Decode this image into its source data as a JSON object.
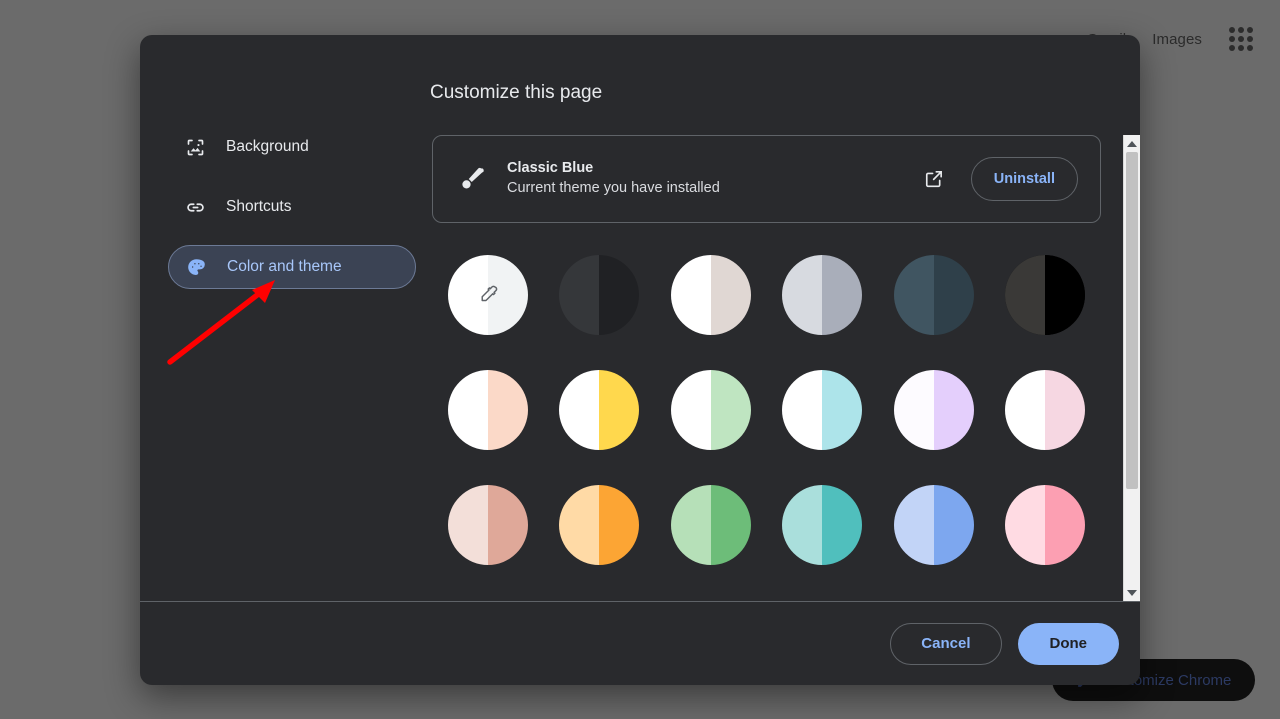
{
  "background_page": {
    "links": [
      {
        "label": "Gmail",
        "name": "gmail-link"
      },
      {
        "label": "Images",
        "name": "images-link"
      }
    ],
    "apps_icon": "apps-grid-icon",
    "customize_chrome": {
      "label": "Customize Chrome",
      "icon": "pencil-icon"
    }
  },
  "dialog": {
    "title": "Customize this page",
    "sidebar": {
      "items": [
        {
          "label": "Background",
          "icon": "image-icon",
          "name": "sidebar-item-background",
          "selected": false
        },
        {
          "label": "Shortcuts",
          "icon": "link-icon",
          "name": "sidebar-item-shortcuts",
          "selected": false
        },
        {
          "label": "Color and theme",
          "icon": "palette-icon",
          "name": "sidebar-item-color-and-theme",
          "selected": true
        }
      ],
      "selected_index": 2
    },
    "theme_card": {
      "icon": "paintbrush-icon",
      "name": "Classic Blue",
      "subtitle": "Current theme you have installed",
      "open_external_icon": "open-in-new-icon",
      "uninstall_label": "Uninstall"
    },
    "swatches": [
      {
        "name": "custom-color-swatch",
        "left": "#ffffff",
        "right": "#f1f3f4",
        "icon": "eyedropper-icon",
        "ring": false
      },
      {
        "name": "swatch-dark-grey",
        "left": "#35373a",
        "right": "#202124",
        "ring": false
      },
      {
        "name": "swatch-warm-beige",
        "left": "#ffffff",
        "right": "#e0d7d3",
        "ring": false
      },
      {
        "name": "swatch-cool-grey",
        "left": "#d7dae0",
        "right": "#a9aeba",
        "ring": false
      },
      {
        "name": "swatch-slate-blue",
        "left": "#405561",
        "right": "#2f404a",
        "ring": false
      },
      {
        "name": "swatch-black",
        "left": "#3a3937",
        "right": "#000000",
        "ring": true
      },
      {
        "name": "swatch-light-peach",
        "left": "#ffffff",
        "right": "#fbd9c8",
        "ring": false
      },
      {
        "name": "swatch-yellow",
        "left": "#ffffff",
        "right": "#ffd84d",
        "ring": false
      },
      {
        "name": "swatch-light-green",
        "left": "#ffffff",
        "right": "#bfe5c1",
        "ring": false
      },
      {
        "name": "swatch-light-cyan",
        "left": "#ffffff",
        "right": "#ade4ea",
        "ring": false
      },
      {
        "name": "swatch-light-purple",
        "left": "#fdfbff",
        "right": "#e4cffc",
        "ring": false
      },
      {
        "name": "swatch-light-pink",
        "left": "#ffffff",
        "right": "#f6d7e2",
        "ring": false
      },
      {
        "name": "swatch-rose-clay",
        "left": "#f3dfd9",
        "right": "#dfa899",
        "ring": false
      },
      {
        "name": "swatch-orange",
        "left": "#ffdaa6",
        "right": "#fca534",
        "ring": false
      },
      {
        "name": "swatch-green",
        "left": "#b6e0b8",
        "right": "#6dbd79",
        "ring": false
      },
      {
        "name": "swatch-teal",
        "left": "#aadfdc",
        "right": "#50bfbd",
        "ring": false
      },
      {
        "name": "swatch-blue",
        "left": "#c2d4f7",
        "right": "#7da7ef",
        "ring": false
      },
      {
        "name": "swatch-pink",
        "left": "#ffdbe3",
        "right": "#fc9fb2",
        "ring": false
      }
    ],
    "scrollbar": {
      "up_arrow": "scroll-up-arrow",
      "down_arrow": "scroll-down-arrow",
      "thumb": "scrollbar-thumb"
    },
    "footer": {
      "cancel_label": "Cancel",
      "done_label": "Done"
    }
  },
  "annotation": {
    "arrow_color": "#ff0000",
    "points_to": "sidebar-item-color-and-theme"
  },
  "colors": {
    "accent_blue": "#8ab4f8",
    "dialog_bg": "#292a2d",
    "selected_nav_bg": "#3b4354",
    "page_scrim": "#6b6b6b"
  }
}
